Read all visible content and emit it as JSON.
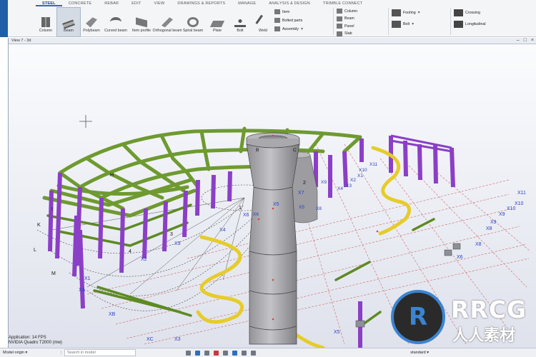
{
  "tabs": [
    "STEEL",
    "CONCRETE",
    "REBAR",
    "EDIT",
    "VIEW",
    "DRAWINGS & REPORTS",
    "MANAGE",
    "ANALYSIS & DESIGN",
    "TRIMBLE CONNECT"
  ],
  "tools": [
    {
      "label": "Column",
      "icon": "column-icon"
    },
    {
      "label": "Beam",
      "icon": "beam-icon"
    },
    {
      "label": "Polybeam",
      "icon": "polybeam-icon"
    },
    {
      "label": "Curved beam",
      "icon": "curved-beam-icon"
    },
    {
      "label": "Item profile",
      "icon": "item-profile-icon"
    },
    {
      "label": "Orthogonal beam",
      "icon": "orthogonal-beam-icon"
    },
    {
      "label": "Spiral beam",
      "icon": "spiral-beam-icon"
    },
    {
      "label": "Plate",
      "icon": "plate-icon"
    },
    {
      "label": "Bolt",
      "icon": "bolt-icon"
    },
    {
      "label": "Weld",
      "icon": "weld-icon"
    }
  ],
  "small_tools": [
    "Item",
    "Bolted parts",
    "Assembly"
  ],
  "detail_tools": [
    "Column",
    "Beam",
    "Panel",
    "Slab"
  ],
  "group_a": [
    "Footing",
    "Bolt"
  ],
  "group_b": [
    "Crossing",
    "Longitudinal"
  ],
  "view": {
    "title": "View 7 - 3d",
    "fps": "Application: 14 FPS",
    "gpu": "NVIDIA Quadro T2000 (mw)"
  },
  "statusbar": {
    "origin": "Model origin",
    "search_placeholder": "Search in model",
    "standard": "standard"
  },
  "watermark": {
    "logo": "R",
    "text": "RRCG",
    "sub": "人人素材"
  },
  "scene_labels": {
    "grid": [
      "K",
      "I",
      "H",
      "L",
      "M",
      "X1",
      "X2",
      "X3",
      "X4",
      "X5",
      "X6",
      "X7",
      "X8",
      "X9",
      "X10",
      "X11",
      "XA",
      "XB",
      "XC",
      "X3",
      "X5",
      "X6",
      "X8",
      "X9",
      "X10",
      "1",
      "2",
      "3",
      "4"
    ],
    "upper": [
      "X1",
      "X2",
      "X3",
      "X4",
      "X5",
      "X6",
      "X8",
      "X9",
      "X10",
      "X11",
      "C",
      "B"
    ]
  },
  "colors": {
    "green_beam": "#6e9a2f",
    "purple_column": "#8b3fc7",
    "concrete": "#a8a8ac",
    "spiral": "#e6cc2a",
    "grid_line": "#cc6666",
    "accent": "#2a6ebc"
  }
}
